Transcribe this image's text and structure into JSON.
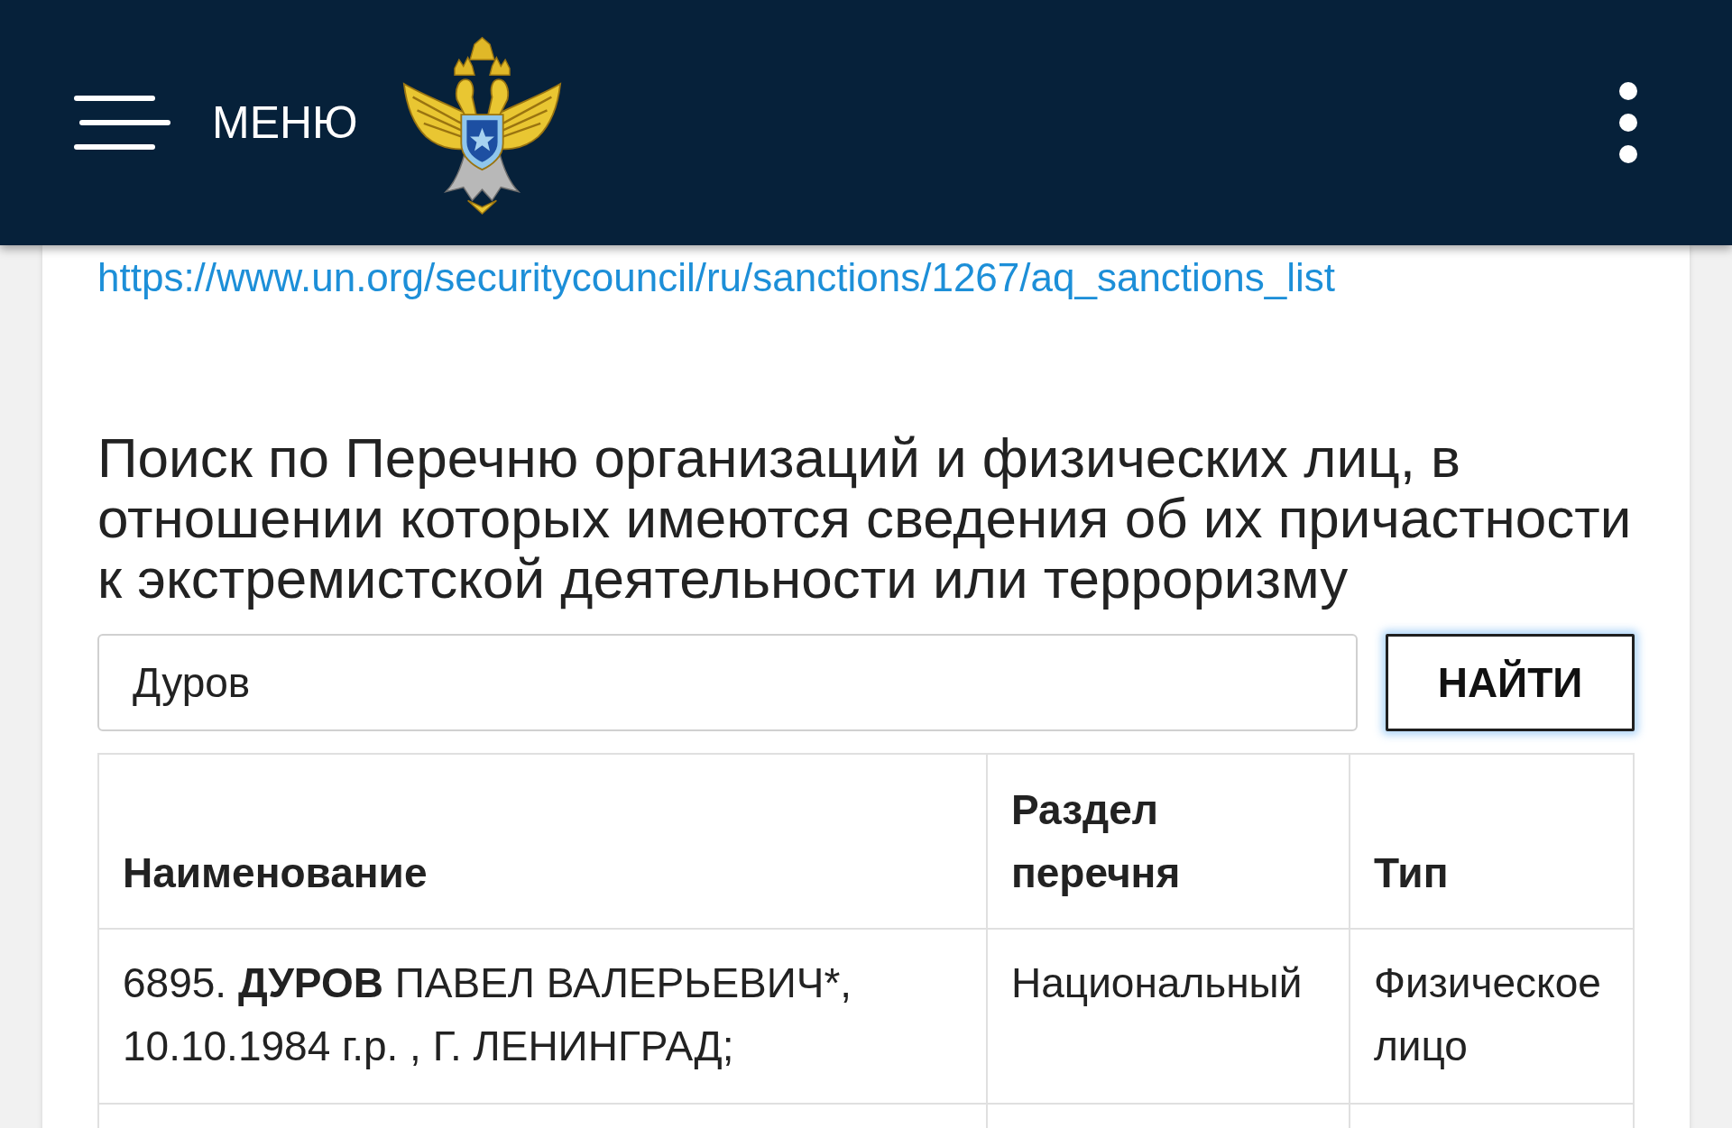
{
  "header": {
    "menu_label": "МЕНЮ"
  },
  "link": "https://www.un.org/securitycouncil/ru/sanctions/1267/aq_sanctions_list",
  "search": {
    "title": "Поиск по Перечню организаций и физических лиц, в отношении которых имеются сведения об их причастности к экстремистской деятельности или терроризму",
    "value": "Дуров",
    "button": "НАЙТИ"
  },
  "table": {
    "columns": [
      "Наименование",
      "Раздел перечня",
      "Тип"
    ],
    "rows": [
      {
        "cells": [
          "6895. **ДУРОВ** ПАВЕЛ ВАЛЕРЬЕВИЧ*, 10.10.1984 г.р. , Г. ЛЕНИНГРАД;",
          "Национальный",
          "Физическое лицо"
        ]
      }
    ]
  }
}
